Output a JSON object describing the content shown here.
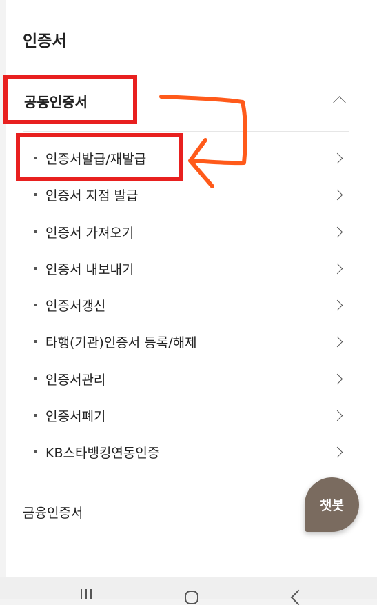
{
  "section_title": "인증서",
  "group": {
    "title": "공동인증서",
    "expanded": true
  },
  "menu_items": [
    {
      "label": "인증서발급/재발급"
    },
    {
      "label": "인증서 지점 발급"
    },
    {
      "label": "인증서 가져오기"
    },
    {
      "label": "인증서 내보내기"
    },
    {
      "label": "인증서갱신"
    },
    {
      "label": "타행(기관)인증서 등록/해제"
    },
    {
      "label": "인증서관리"
    },
    {
      "label": "인증서폐기"
    },
    {
      "label": "KB스타뱅킹연동인증"
    }
  ],
  "finance_cert": "금융인증서",
  "chatbot": "챗봇",
  "colors": {
    "annotation_red": "#e8201f",
    "annotation_orange": "#ff5a1a",
    "chatbot_bg": "#7a6b5f"
  }
}
